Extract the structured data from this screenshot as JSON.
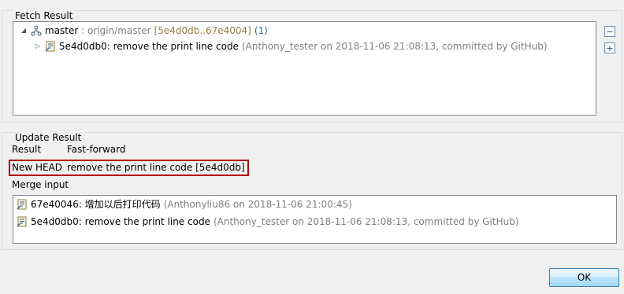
{
  "fetch": {
    "title": "Fetch Result",
    "branch": {
      "name": "master",
      "separator": " : ",
      "remote": "origin/master",
      "range": "[5e4d0db..67e4004]",
      "count": "(1)"
    },
    "commit": {
      "id_message": "5e4d0db0: remove the print line code",
      "meta": "(Anthony_tester on 2018-11-06 21:08:13, committed by GitHub)"
    },
    "collapse_all_icon": "collapse-all-icon",
    "expand_all_icon": "expand-all-icon"
  },
  "update": {
    "title": "Update Result",
    "result_label": "Result",
    "result_value": "Fast-forward",
    "new_head_label": "New HEAD",
    "new_head_value": "remove the print line code [5e4d0db]",
    "merge_input_label": "Merge input",
    "merge_items": [
      {
        "id_message": "67e40046: 增加以后打印代码",
        "meta": "(Anthonyliu86 on 2018-11-06 21:00:45)"
      },
      {
        "id_message": "5e4d0db0: remove the print line code",
        "meta": "(Anthony_tester on 2018-11-06 21:08:13, committed by GitHub)"
      }
    ]
  },
  "buttons": {
    "ok": "OK"
  },
  "colors": {
    "highlight_border": "#b00000",
    "decoration": "#957d47",
    "count": "#2f6ea5"
  }
}
